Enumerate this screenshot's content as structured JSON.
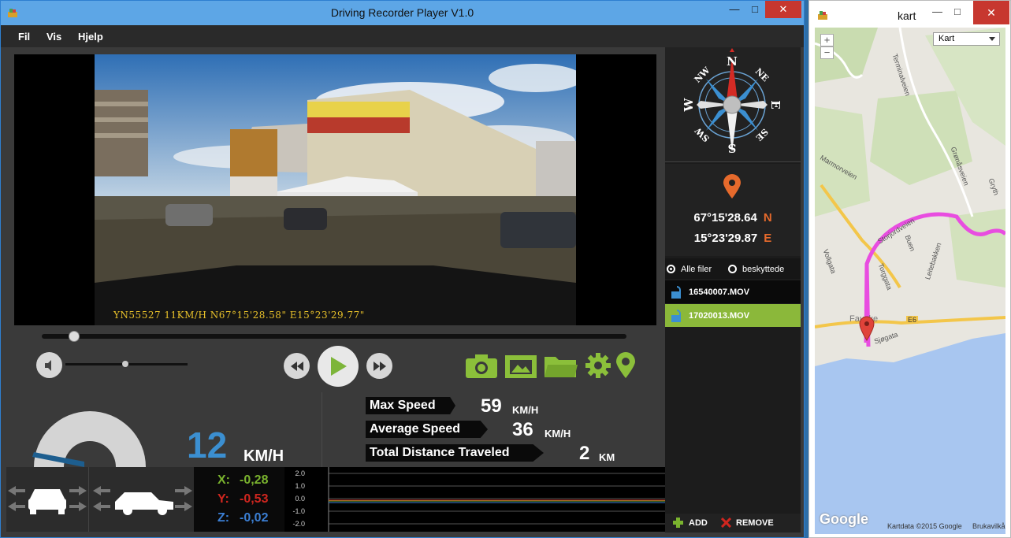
{
  "main_window": {
    "title": "Driving Recorder Player V1.0",
    "controls": {
      "minimize": "—",
      "maximize": "□",
      "close": "✕"
    }
  },
  "menu": [
    {
      "label": "Fil"
    },
    {
      "label": "Vis"
    },
    {
      "label": "Hjelp"
    }
  ],
  "video": {
    "overlay": "YN55527    11KM/H N67°15'28.58\" E15°23'29.77\""
  },
  "playback": {
    "seek_progress": 0.05,
    "volume_level": 0.5
  },
  "toolbar": {
    "icons": [
      "camera-icon",
      "gallery-icon",
      "folder-icon",
      "settings-icon",
      "location-icon"
    ],
    "accent": "#8bbf3a"
  },
  "speed": {
    "current": "12",
    "unit": "KM/H"
  },
  "stats": {
    "max_label": "Max Speed",
    "max_value": "59",
    "max_unit": "KM/H",
    "avg_label": "Average Speed",
    "avg_value": "36",
    "avg_unit": "KM/H",
    "dist_label": "Total Distance Traveled",
    "dist_value": "2",
    "dist_unit": "KM"
  },
  "gsensor": {
    "x_label": "X:",
    "x_value": "-0,28",
    "y_label": "Y:",
    "y_value": "-0,53",
    "z_label": "Z:",
    "z_value": "-0,02",
    "colors": {
      "x": "#7ab32e",
      "y": "#d0261f",
      "z": "#3b7fd4"
    },
    "axis_ticks": [
      "2.0",
      "1.0",
      "0.0",
      "-1.0",
      "-2.0"
    ]
  },
  "compass": {
    "labels": [
      "N",
      "NE",
      "E",
      "SE",
      "S",
      "SW",
      "W",
      "NW"
    ]
  },
  "gps": {
    "lat": "67°15'28.64",
    "lat_dir": "N",
    "lon": "15°23'29.87",
    "lon_dir": "E"
  },
  "files": {
    "filter_all": "Alle filer",
    "filter_protected": "beskyttede",
    "items": [
      {
        "name": "16540007.MOV",
        "selected": false
      },
      {
        "name": "17020013.MOV",
        "selected": true
      }
    ],
    "add_label": "ADD",
    "remove_label": "REMOVE"
  },
  "map_window": {
    "title": "kart",
    "controls": {
      "minimize": "—",
      "maximize": "□",
      "close": "✕"
    },
    "zoom_in": "+",
    "zoom_out": "−",
    "map_type": "Kart",
    "streets": [
      "Terminalveien",
      "Marmorveien",
      "Grønåsveien",
      "Gryth",
      "Storjordveien",
      "Vollgata",
      "Buen",
      "Torggata",
      "Leitebakken",
      "Fauske",
      "E6",
      "Sjøgata"
    ],
    "google_logo": "Google",
    "attribution": "Kartdata ©2015 Google",
    "terms": "Brukavilkår"
  }
}
